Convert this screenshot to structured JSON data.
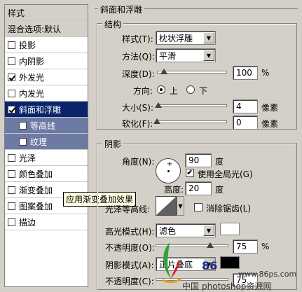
{
  "style_list": {
    "header": "样式",
    "blending_options": "混合选项:默认",
    "items": [
      {
        "label": "投影",
        "checked": false
      },
      {
        "label": "内阴影",
        "checked": false
      },
      {
        "label": "外发光",
        "checked": true
      },
      {
        "label": "内发光",
        "checked": false
      },
      {
        "label": "斜面和浮雕",
        "checked": true,
        "selected": true
      },
      {
        "label": "等高线",
        "checked": false,
        "sub": true
      },
      {
        "label": "纹理",
        "checked": false,
        "sub": true
      },
      {
        "label": "光泽",
        "checked": false
      },
      {
        "label": "颜色叠加",
        "checked": false
      },
      {
        "label": "渐变叠加",
        "checked": false
      },
      {
        "label": "图案叠加",
        "checked": false
      },
      {
        "label": "描边",
        "checked": false
      }
    ]
  },
  "tooltip": "应用渐变叠加效果",
  "bevel_emboss": {
    "title": "斜面和浮雕",
    "structure": {
      "title": "结构",
      "style_label": "样式(T):",
      "style_value": "枕状浮雕",
      "technique_label": "方法(Q):",
      "technique_value": "平滑",
      "depth_label": "深度(D):",
      "depth_value": "100",
      "depth_unit": "%",
      "depth_level": 0.1,
      "direction_label": "方向:",
      "direction_up": "上",
      "direction_down": "下",
      "size_label": "大小(S):",
      "size_value": "4",
      "size_unit": "像素",
      "size_level": 0.02,
      "soften_label": "软化(F):",
      "soften_value": "0",
      "soften_unit": "像素",
      "soften_level": 0.0
    },
    "shading": {
      "title": "阴影",
      "angle_label": "角度(N):",
      "angle_value": "90",
      "angle_unit": "度",
      "global_light_label": "使用全局光(G)",
      "altitude_label": "高度:",
      "altitude_value": "20",
      "altitude_unit": "度",
      "gloss_contour_label": "光泽等高线:",
      "anti_alias_label": "消除锯齿(L)",
      "highlight_mode_label": "高光模式(H):",
      "highlight_mode_value": "滤色",
      "highlight_color": "#ffffff",
      "highlight_opacity_label": "不透明度(O):",
      "highlight_opacity_value": "75",
      "highlight_opacity_unit": "%",
      "highlight_opacity_level": 0.75,
      "shadow_mode_label": "阴影模式(A):",
      "shadow_mode_value": "正片叠底",
      "shadow_color": "#000000",
      "shadow_opacity_label": "不透明度(C):",
      "shadow_opacity_value": "75"
    }
  },
  "watermark": {
    "url": "www.86ps.com",
    "text1": "中国",
    "text2": "photoshop资源网",
    "logo_digits": "86"
  }
}
